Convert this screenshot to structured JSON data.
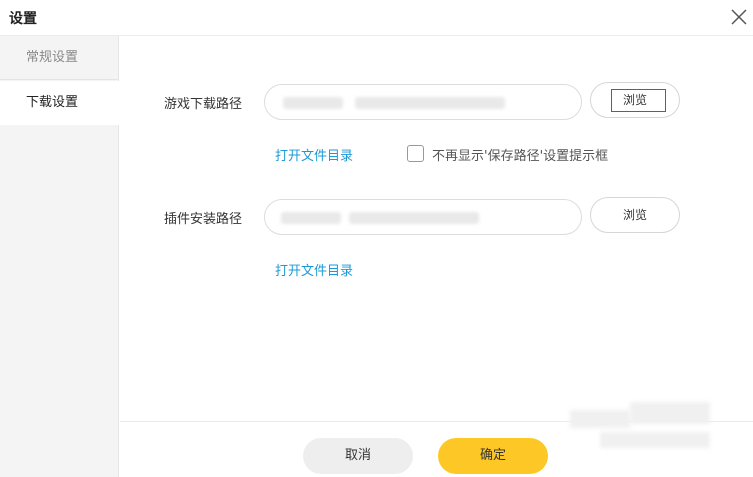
{
  "window": {
    "title": "设置"
  },
  "sidebar": {
    "items": [
      {
        "label": "常规设置",
        "active": false
      },
      {
        "label": "下载设置",
        "active": true
      }
    ]
  },
  "game_download": {
    "label": "游戏下载路径",
    "browse_label": "浏览",
    "open_dir_label": "打开文件目录",
    "checkbox_label": "不再显示'保存路径'设置提示框",
    "checkbox_checked": false
  },
  "plugin_install": {
    "label": "插件安装路径",
    "browse_label": "浏览",
    "open_dir_label": "打开文件目录"
  },
  "footer": {
    "cancel_label": "取消",
    "ok_label": "确定"
  },
  "colors": {
    "accent": "#fdc825",
    "link": "#1a9ad6",
    "highlight_border": "#e02b2b"
  }
}
